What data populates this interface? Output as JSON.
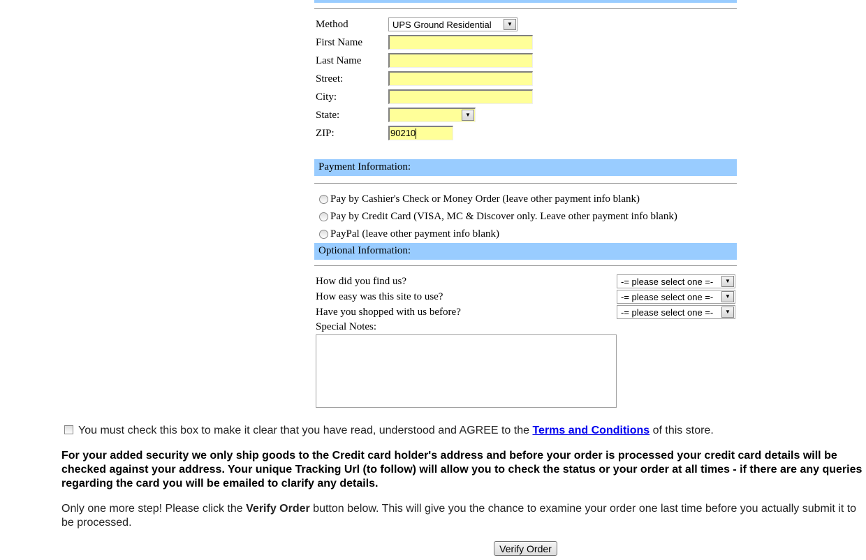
{
  "shipping": {
    "method_label": "Method",
    "method_value": "UPS Ground Residential",
    "first_name_label": "First Name",
    "last_name_label": "Last Name",
    "street_label": "Street:",
    "city_label": "City:",
    "state_label": "State:",
    "state_value": "",
    "zip_label": "ZIP:",
    "zip_value": "90210"
  },
  "payment": {
    "header": "Payment Information:",
    "options": [
      "Pay by Cashier's Check or Money Order (leave other payment info blank)",
      "Pay by Credit Card (VISA, MC & Discover only. Leave other payment info blank)",
      "PayPal (leave other payment info blank)"
    ]
  },
  "optional": {
    "header": "Optional Information:",
    "questions": [
      {
        "label": "How did you find us?",
        "value": "-= please select one =-"
      },
      {
        "label": "How easy was this site to use?",
        "value": "-= please select one =-"
      },
      {
        "label": "Have you shopped with us before?",
        "value": "-= please select one =-"
      }
    ],
    "notes_label": "Special Notes:"
  },
  "terms": {
    "before": "You must check this box to make it clear that you have read, understood and AGREE to the ",
    "link": "Terms and Conditions",
    "after": " of this store."
  },
  "security_lines": [
    "For your added security we only ship goods to the Credit card holder's address and before your order is processed your credit card details will be checked against",
    "your address. Your unique Tracking Url (to follow) will allow you to check the status or your order at all times - if there are any queries regarding the card you will be",
    "emailed to clarify any details."
  ],
  "step": {
    "before": "Only one more step! Please click the ",
    "bold": "Verify Order",
    "after": " button below. This will give you the chance to examine your order one last time before you actually submit it to be processed."
  },
  "verify_button": "Verify Order",
  "colors": {
    "section_header": "#99ccff",
    "input_bg": "#ffff99",
    "link": "#0000ee"
  }
}
